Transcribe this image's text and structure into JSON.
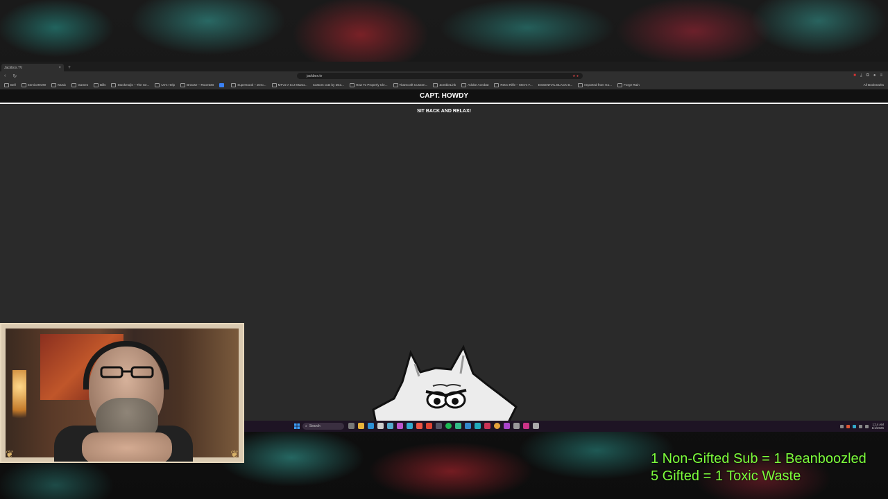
{
  "browser": {
    "tab_label": "Jackbox.TV",
    "url": "jackbox.tv",
    "bookmarks": [
      "Bell",
      "ServiceNOW",
      "Music",
      "Games",
      "Bills",
      "Stockmojis – The Se...",
      "Un's Help",
      "Browse – RoomDB",
      "",
      "SuperCook – Zero...",
      "MTV2 A to Z Marat...",
      "Custom cuts by Dea...",
      "How To Properly Cle...",
      "TitanCraft Custom...",
      "ZombieLink",
      "Adobe Acrobat",
      "Retro Rifle – Men's F...",
      "ESSENTIAL BLACK B...",
      "Imported from Go...",
      "Forge Rain"
    ],
    "all_bookmarks_label": "All Bookmarks"
  },
  "page": {
    "player_name": "CAPT. HOWDY",
    "status": "SIT BACK AND RELAX!"
  },
  "taskbar": {
    "search_label": "Search",
    "time": "1:14 AM",
    "date": "1/1/2026"
  },
  "overlay": {
    "line1": "1 Non-Gifted Sub = 1 Beanboozled",
    "line2": "5 Gifted = 1 Toxic Waste",
    "text_color": "#7dff3c"
  }
}
